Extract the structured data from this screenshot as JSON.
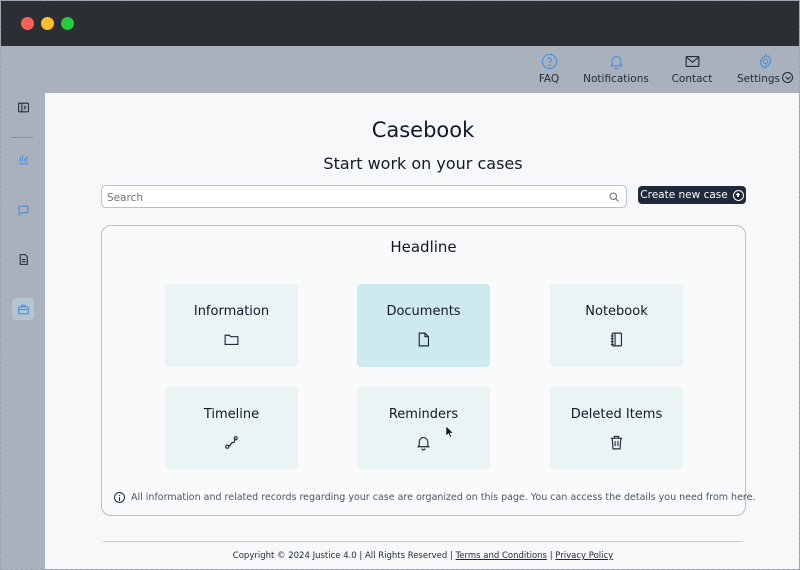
{
  "topnav": {
    "faq": "FAQ",
    "notifications": "Notifications",
    "contact": "Contact",
    "settings": "Settings"
  },
  "sidebar": {
    "icons": [
      "panel-toggle-icon",
      "chart-icon",
      "chat-icon",
      "document-icon",
      "briefcase-icon"
    ]
  },
  "page": {
    "title": "Casebook",
    "subtitle": "Start work on your cases"
  },
  "search": {
    "placeholder": "Search"
  },
  "create_button": {
    "label": "Create new case"
  },
  "headline": {
    "title": "Headline",
    "tiles": [
      {
        "label": "Information",
        "icon": "folder-icon"
      },
      {
        "label": "Documents",
        "icon": "file-icon"
      },
      {
        "label": "Notebook",
        "icon": "notebook-icon"
      },
      {
        "label": "Timeline",
        "icon": "route-icon"
      },
      {
        "label": "Reminders",
        "icon": "bell-icon"
      },
      {
        "label": "Deleted Items",
        "icon": "trash-icon"
      }
    ],
    "info": "All information and related records regarding your case are organized on this page. You can access the details you need from here."
  },
  "footer": {
    "copyright": "Copyright © 2024 Justice 4.0 | All Rights Reserved |",
    "terms": "Terms and Conditions",
    "sep": "|",
    "privacy": "Privacy Policy"
  },
  "colors": {
    "titlebar": "#2b2e33",
    "chrome": "#a9b1bc",
    "accent_blue": "#4a90d9",
    "button_dark": "#1e2a3b",
    "tile_bg": "#eaf4f5",
    "tile_active": "#cdeaf0"
  }
}
